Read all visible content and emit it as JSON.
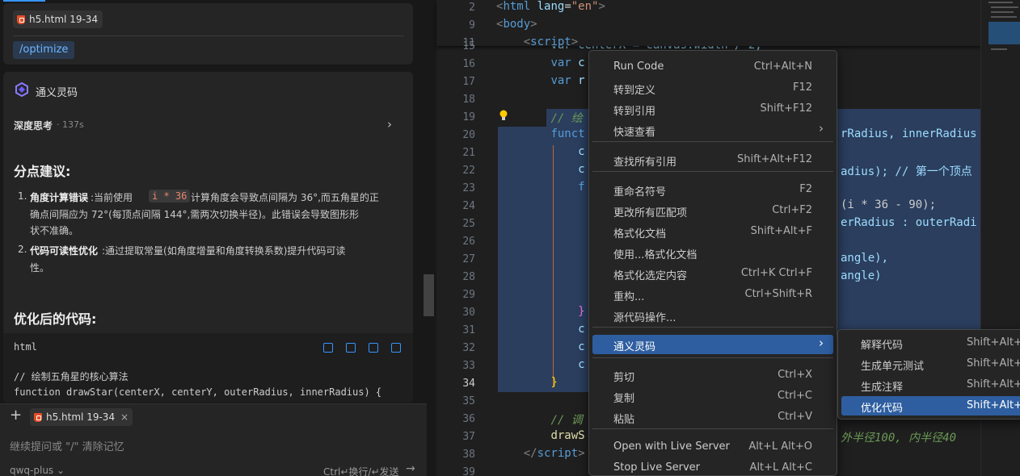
{
  "chat": {
    "ref_chip": "h5.html 19-34",
    "command": "/optimize",
    "assistant_name": "通义灵码",
    "thinking_label": "深度思考",
    "thinking_time": "· 137s",
    "section1": "分点建议:",
    "item1_num": "1.",
    "item1_bold": "角度计算错误",
    "item1_text_a": ":当前使用",
    "item1_code": "i * 36",
    "item1_text_b": "计算角度会导致点间隔为 36°,而五角星的正",
    "item1_line2": "确点间隔应为 72°(每顶点间隔 144°,需两次切换半径)。此错误会导致图形形",
    "item1_line3": "状不准确。",
    "item2_num": "2.",
    "item2_bold": "代码可读性优化",
    "item2_text": ":通过提取常量(如角度增量和角度转换系数)提升代码可读",
    "item2_line2": "性。",
    "section2": "优化后的代码:",
    "code_lang": "html",
    "code_line1": "// 绘制五角星的核心算法",
    "code_line2": "function drawStar(centerX, centerY, outerRadius, innerRadius) {",
    "input_chip": "h5.html 19-34",
    "input_placeholder": "继续提问或 \"/\" 清除记忆",
    "model": "qwq-plus",
    "send_hint": "Ctrl↵换行/↵发送"
  },
  "editor": {
    "sticky": [
      {
        "n": "2",
        "html": "<span class=\"br\">&lt;</span><span class=\"tg\">html</span> <span class=\"id\">lang</span>=<span style=\"color:#ce9178\">\"en\"</span><span class=\"br\">&gt;</span>"
      },
      {
        "n": "9",
        "html": "<span class=\"br\">&lt;</span><span class=\"tg\">body</span><span class=\"br\">&gt;</span>"
      },
      {
        "n": "11",
        "html": "    <span class=\"br\">&lt;</span><span class=\"tg\">script</span><span class=\"br\">&gt;</span>"
      }
    ],
    "lines": [
      {
        "n": "16",
        "html": "        <span class=\"kw\">var</span> <span class=\"id\">c</span>"
      },
      {
        "n": "17",
        "html": "        <span class=\"kw\">var</span> <span class=\"id\">r</span>"
      },
      {
        "n": "18",
        "html": ""
      },
      {
        "n": "19",
        "html": "        <span class=\"cm\">// 绘</span>"
      },
      {
        "n": "20",
        "html": "        <span class=\"kw\">funct</span>"
      },
      {
        "n": "21",
        "html": "            <span class=\"id\">c</span>"
      },
      {
        "n": "22",
        "html": "            <span class=\"id\">c</span>"
      },
      {
        "n": "23",
        "html": "            <span class=\"kw\">f</span>"
      },
      {
        "n": "24",
        "html": ""
      },
      {
        "n": "25",
        "html": ""
      },
      {
        "n": "26",
        "html": ""
      },
      {
        "n": "27",
        "html": ""
      },
      {
        "n": "28",
        "html": ""
      },
      {
        "n": "29",
        "html": ""
      },
      {
        "n": "30",
        "html": "            <span style=\"color:#da70d6\">}</span>"
      },
      {
        "n": "31",
        "html": "            <span class=\"id\">c</span>"
      },
      {
        "n": "32",
        "html": "            <span class=\"id\">c</span>"
      },
      {
        "n": "33",
        "html": "            <span class=\"id\">c</span>"
      },
      {
        "n": "34",
        "html": "        <span style=\"color:#ffd700\">}</span>"
      },
      {
        "n": "35",
        "html": ""
      },
      {
        "n": "36",
        "html": "        <span class=\"cm\">// 调</span>"
      },
      {
        "n": "37",
        "html": "        <span class=\"fn\">drawS</span>"
      },
      {
        "n": "38",
        "html": "    <span class=\"br\">&lt;/</span><span class=\"tg\">script</span><span class=\"br\">&gt;</span>"
      },
      {
        "n": "39",
        "html": ""
      }
    ],
    "line15": "        var centerX = canvas.width / 2;",
    "line15_num": "15",
    "right_frag": [
      "rRadius, innerRadius",
      "adius); // 第一个顶点",
      "(i * 36 - 90);",
      "erRadius : outerRadi",
      "angle),",
      "angle)",
      "外半径100, 内半径40"
    ]
  },
  "menu": {
    "items": [
      {
        "label": "Run Code",
        "key": "Ctrl+Alt+N"
      },
      {
        "label": "转到定义",
        "key": "F12"
      },
      {
        "label": "转到引用",
        "key": "Shift+F12"
      },
      {
        "label": "快速查看",
        "key": "›"
      },
      {
        "label": "查找所有引用",
        "key": "Shift+Alt+F12"
      },
      {
        "label": "重命名符号",
        "key": "F2"
      },
      {
        "label": "更改所有匹配项",
        "key": "Ctrl+F2"
      },
      {
        "label": "格式化文档",
        "key": "Shift+Alt+F"
      },
      {
        "label": "使用...格式化文档",
        "key": ""
      },
      {
        "label": "格式化选定内容",
        "key": "Ctrl+K Ctrl+F"
      },
      {
        "label": "重构...",
        "key": "Ctrl+Shift+R"
      },
      {
        "label": "源代码操作...",
        "key": ""
      },
      {
        "label": "通义灵码",
        "key": "›"
      },
      {
        "label": "剪切",
        "key": "Ctrl+X"
      },
      {
        "label": "复制",
        "key": "Ctrl+C"
      },
      {
        "label": "粘贴",
        "key": "Ctrl+V"
      },
      {
        "label": "Open with Live Server",
        "key": "Alt+L Alt+O"
      },
      {
        "label": "Stop Live Server",
        "key": "Alt+L Alt+C"
      }
    ]
  },
  "submenu": {
    "items": [
      {
        "label": "解释代码",
        "key": "Shift+Alt+P"
      },
      {
        "label": "生成单元测试",
        "key": "Shift+Alt+U"
      },
      {
        "label": "生成注释",
        "key": "Shift+Alt+V"
      },
      {
        "label": "优化代码",
        "key": "Shift+Alt+M"
      }
    ]
  },
  "colors": {
    "accent": "#3794ff",
    "menu_highlight": "#2e5ea0",
    "selection": "#2b3e5e"
  }
}
